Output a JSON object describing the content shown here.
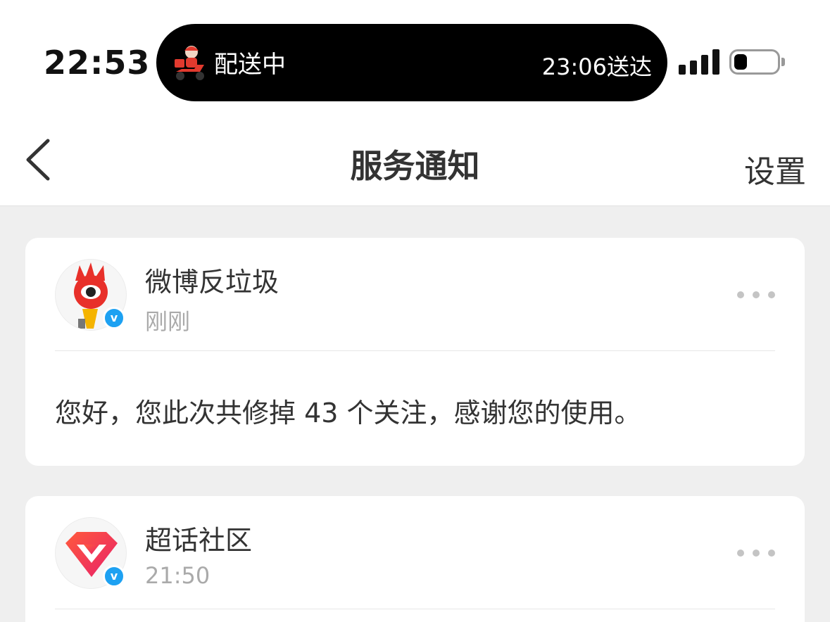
{
  "status_bar": {
    "time": "22:53",
    "live_activity": {
      "status": "配送中",
      "eta": "23:06送达"
    }
  },
  "navbar": {
    "title": "服务通知",
    "settings_label": "设置"
  },
  "notifications": [
    {
      "sender": "微博反垃圾",
      "time": "刚刚",
      "message": "您好，您此次共修掉 43 个关注，感谢您的使用。",
      "verified_mark": "v"
    },
    {
      "sender": "超话社区",
      "time": "21:50",
      "verified_mark": "v"
    }
  ],
  "colors": {
    "verified": "#1da1f2",
    "delivery_red": "#e23a2e",
    "background": "#efefef"
  }
}
